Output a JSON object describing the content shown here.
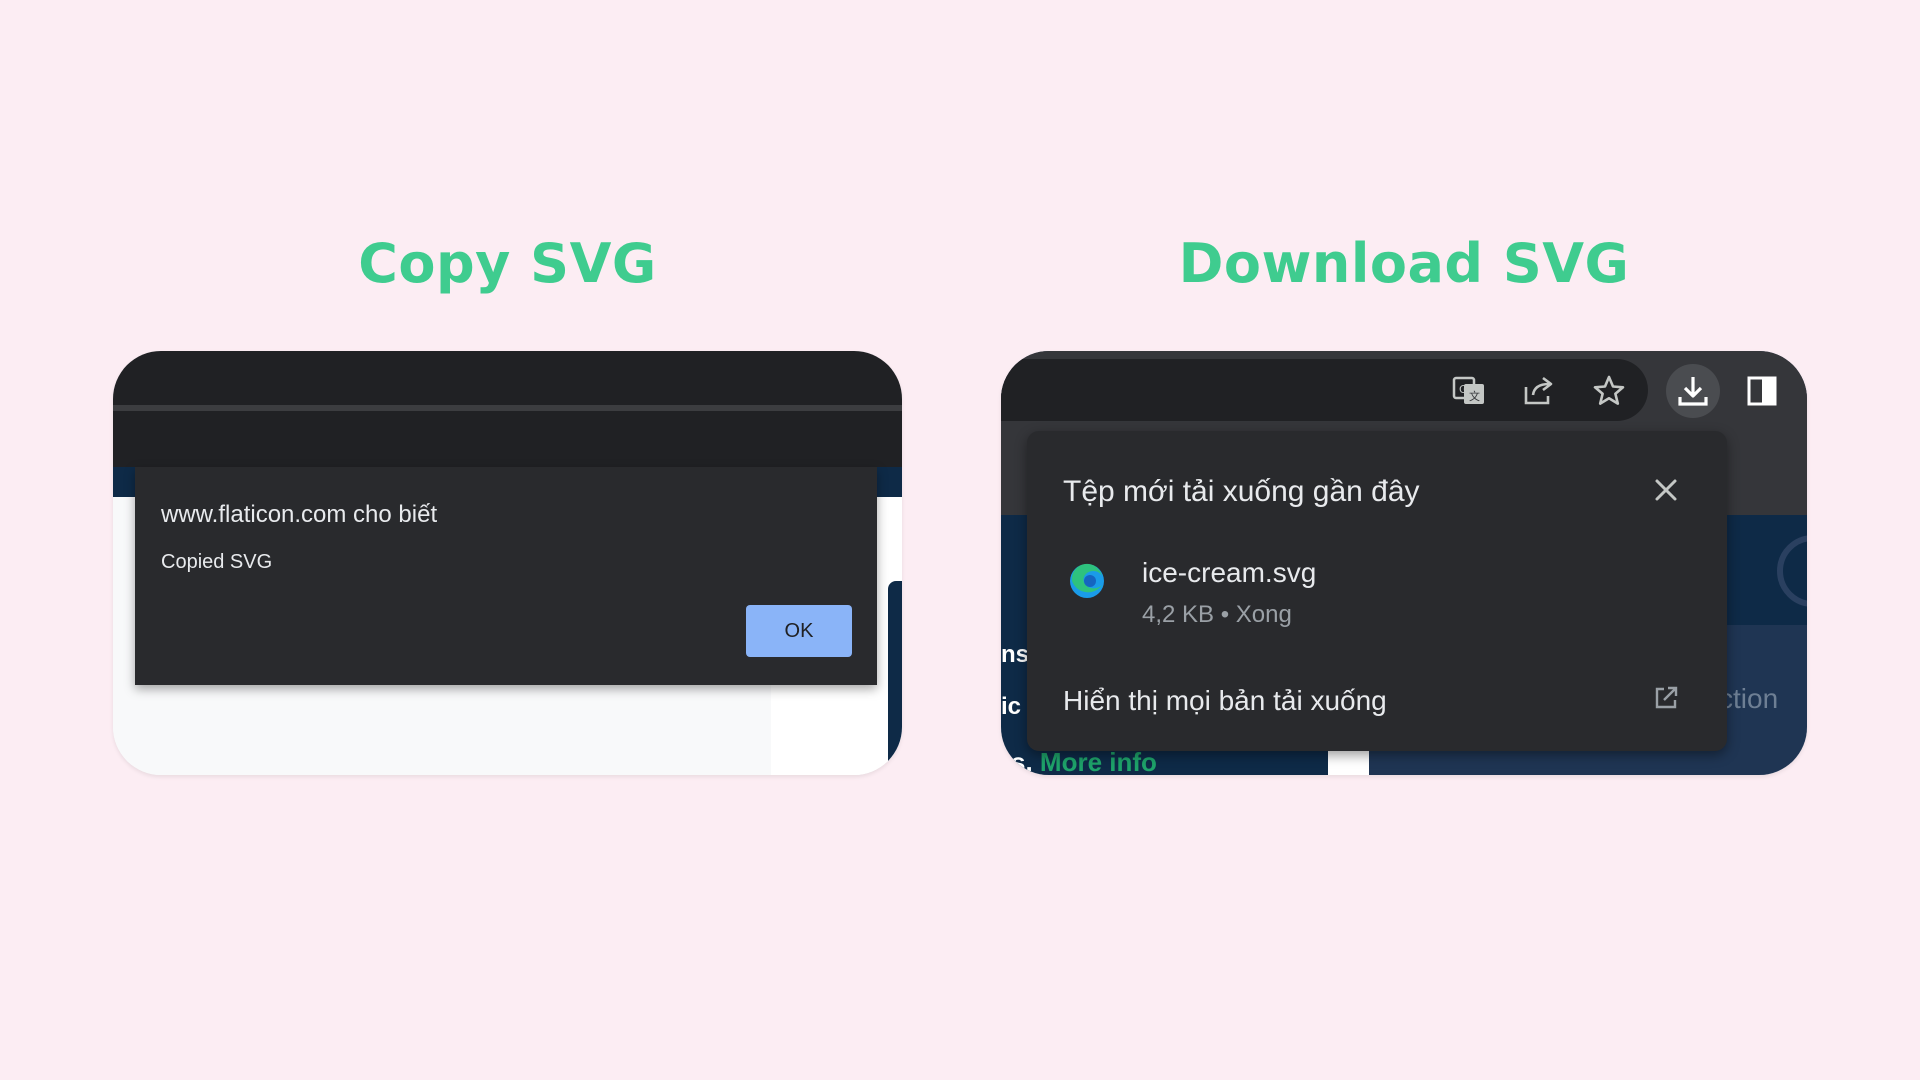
{
  "headings": {
    "copy": "Copy SVG",
    "download": "Download SVG"
  },
  "alert_dialog": {
    "title": "www.flaticon.com cho biết",
    "message": "Copied SVG",
    "ok_label": "OK"
  },
  "download_bubble": {
    "title": "Tệp mới tải xuống gần đây",
    "file": {
      "name": "ice-cream.svg",
      "meta": "4,2 KB • Xong",
      "icon": "edge-browser-icon"
    },
    "show_all_label": "Hiển thị mọi bản tải xuống"
  },
  "background_page": {
    "more_info": "More info",
    "fragment_1": "ns",
    "fragment_2": "ic",
    "fragment_3": "s.",
    "fragment_4": "ction"
  },
  "toolbar_icons": [
    "translate-icon",
    "share-icon",
    "star-icon",
    "download-icon",
    "side-panel-icon"
  ],
  "colors": {
    "page_background": "#fcedf3",
    "heading": "#3fcc8f",
    "dialog_bg": "#292a2d",
    "ok_button": "#8ab4f8",
    "more_info_link": "#1ea36a"
  }
}
